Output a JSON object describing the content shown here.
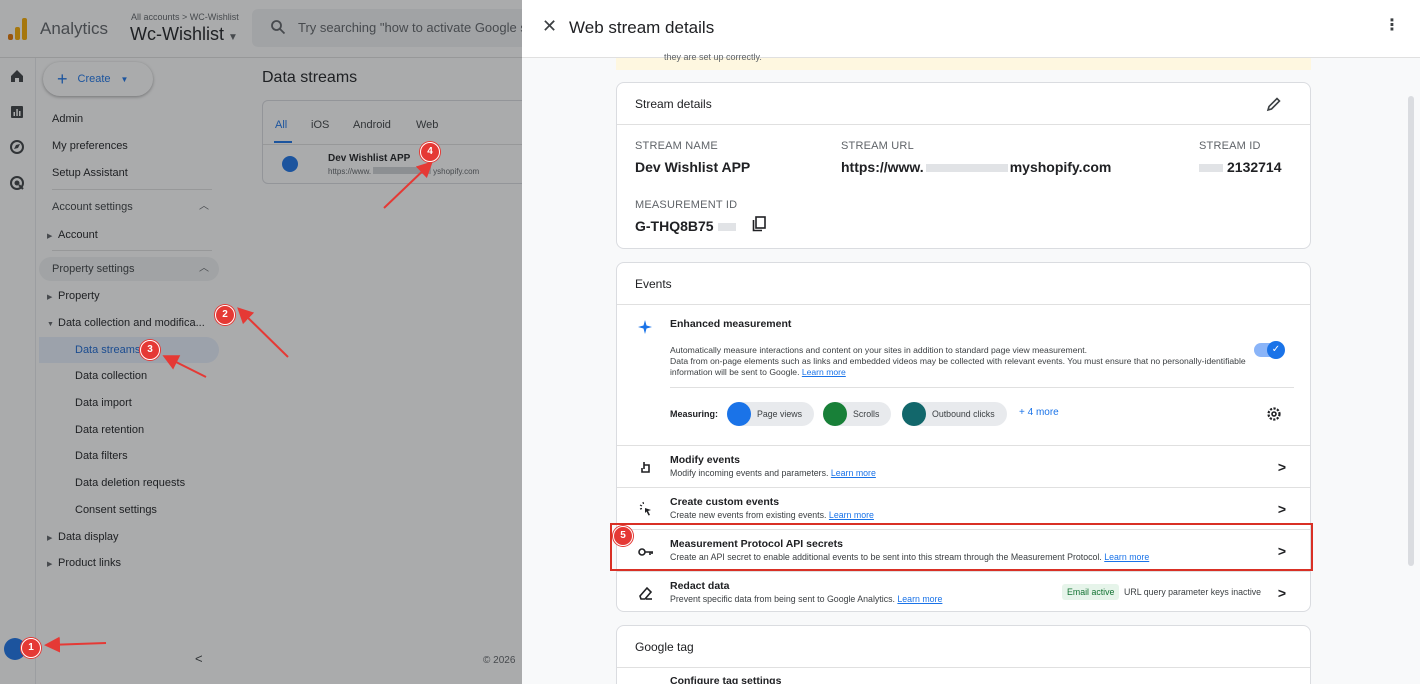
{
  "topbar": {
    "product_name": "Analytics",
    "breadcrumb": "All accounts > WC-Wishlist",
    "account_name": "Wc-Wishlist",
    "search_placeholder": "Try searching \"how to activate Google s"
  },
  "nav": {
    "create_label": "Create",
    "items": [
      "Admin",
      "My preferences",
      "Setup Assistant"
    ],
    "account_settings": "Account settings",
    "account": "Account",
    "property_settings": "Property settings",
    "property": "Property",
    "data_collection_mod": "Data collection and modifica...",
    "data_streams": "Data streams",
    "sub_items": [
      "Data collection",
      "Data import",
      "Data retention",
      "Data filters",
      "Data deletion requests",
      "Consent settings"
    ],
    "data_display": "Data display",
    "product_links": "Product links"
  },
  "main": {
    "title": "Data streams",
    "tabs": [
      "All",
      "iOS",
      "Android",
      "Web"
    ],
    "stream_name": "Dev Wishlist APP",
    "stream_url_start": "https://www.",
    "stream_url_end": "yshopify.com",
    "footer": "© 2026"
  },
  "drawer": {
    "title": "Web stream details",
    "warning_text": "they are set up correctly.",
    "stream_details": {
      "heading": "Stream details",
      "name_label": "STREAM NAME",
      "name_value": "Dev Wishlist APP",
      "url_label": "STREAM URL",
      "url_start": "https://www.",
      "url_end": "myshopify.com",
      "id_label": "STREAM ID",
      "id_value": "2132714",
      "mid_label": "MEASUREMENT ID",
      "mid_value": "G-THQ8B75"
    },
    "events": {
      "heading": "Events",
      "enhanced_title": "Enhanced measurement",
      "enhanced_desc1": "Automatically measure interactions and content on your sites in addition to standard page view measurement.",
      "enhanced_desc2": "Data from on-page elements such as links and embedded videos may be collected with relevant events. You must ensure that no personally-identifiable information will be sent to Google.",
      "learn_more": "Learn more",
      "measuring_label": "Measuring:",
      "chips": [
        "Page views",
        "Scrolls",
        "Outbound clicks"
      ],
      "more": "+ 4 more",
      "rows": [
        {
          "title": "Modify events",
          "desc": "Modify incoming events and parameters."
        },
        {
          "title": "Create custom events",
          "desc": "Create new events from existing events."
        },
        {
          "title": "Measurement Protocol API secrets",
          "desc": "Create an API secret to enable additional events to be sent into this stream through the Measurement Protocol."
        },
        {
          "title": "Redact data",
          "desc": "Prevent specific data from being sent to Google Analytics."
        }
      ],
      "email_badge": "Email active",
      "url_badge": "URL query parameter keys inactive"
    },
    "google_tag": {
      "heading": "Google tag",
      "configure": "Configure tag settings"
    }
  },
  "annotations": [
    "1",
    "2",
    "3",
    "4",
    "5"
  ],
  "colors": {
    "accent": "#1a73e8",
    "annotation": "#e53935"
  }
}
